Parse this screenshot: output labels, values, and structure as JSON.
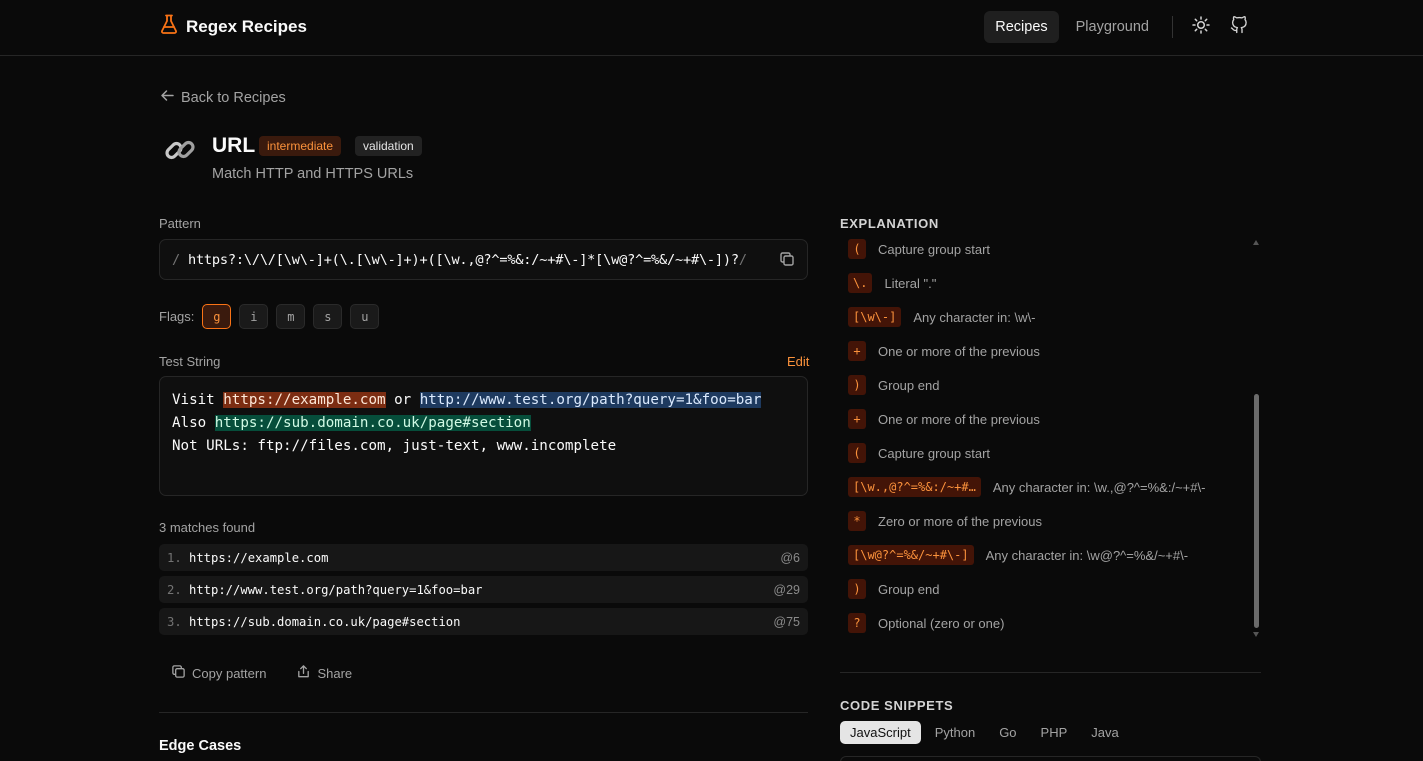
{
  "header": {
    "brand": "Regex Recipes",
    "nav": [
      {
        "label": "Recipes",
        "active": true
      },
      {
        "label": "Playground",
        "active": false
      }
    ],
    "icons": [
      "flask-icon",
      "sun-icon",
      "github-icon"
    ]
  },
  "back_link": "Back to Recipes",
  "recipe": {
    "icon": "link-icon",
    "title": "URL",
    "difficulty": "intermediate",
    "category": "validation",
    "description": "Match HTTP and HTTPS URLs"
  },
  "pattern": {
    "label": "Pattern",
    "open_delim": "/",
    "source": "https?:\\/\\/[\\w\\-]+(\\.[\\w\\-]+)+([\\w.,@?^=%&:/~+#\\-]*[\\w@?^=%&/~+#\\-])?",
    "close_delim": "/"
  },
  "flags": {
    "label": "Flags:",
    "items": [
      {
        "label": "g",
        "on": true
      },
      {
        "label": "i",
        "on": false
      },
      {
        "label": "m",
        "on": false
      },
      {
        "label": "s",
        "on": false
      },
      {
        "label": "u",
        "on": false
      }
    ]
  },
  "test_string": {
    "label": "Test String",
    "edit_label": "Edit",
    "line1_pre": "Visit ",
    "line1_m1": "https://example.com",
    "line1_mid": " or ",
    "line1_m2": "http://www.test.org/path?query=1&foo=bar",
    "line2_pre": "Also ",
    "line2_m3": "https://sub.domain.co.uk/page#section",
    "line3": "Not URLs: ftp://files.com, just-text, www.incomplete"
  },
  "matches": {
    "summary": "3 matches found",
    "items": [
      {
        "index": "1.",
        "value": "https://example.com",
        "pos": "@6"
      },
      {
        "index": "2.",
        "value": "http://www.test.org/path?query=1&foo=bar",
        "pos": "@29"
      },
      {
        "index": "3.",
        "value": "https://sub.domain.co.uk/page#section",
        "pos": "@75"
      }
    ]
  },
  "actions": {
    "copy": "Copy pattern",
    "share": "Share"
  },
  "edge_cases_title": "Edge Cases",
  "explanation": {
    "title": "EXPLANATION",
    "items": [
      {
        "token": "(",
        "desc": "Capture group start"
      },
      {
        "token": "\\.",
        "desc": "Literal \".\""
      },
      {
        "token": "[\\w\\-]",
        "desc": "Any character in: \\w\\-"
      },
      {
        "token": "+",
        "desc": "One or more of the previous"
      },
      {
        "token": ")",
        "desc": "Group end"
      },
      {
        "token": "+",
        "desc": "One or more of the previous"
      },
      {
        "token": "(",
        "desc": "Capture group start"
      },
      {
        "token": "[\\w.,@?^=%&:/~+#…",
        "desc": "Any character in: \\w.,@?^=%&:/~+#\\-"
      },
      {
        "token": "*",
        "desc": "Zero or more of the previous"
      },
      {
        "token": "[\\w@?^=%&/~+#\\-]",
        "desc": "Any character in: \\w@?^=%&/~+#\\-"
      },
      {
        "token": ")",
        "desc": "Group end"
      },
      {
        "token": "?",
        "desc": "Optional (zero or one)"
      }
    ]
  },
  "snippets": {
    "title": "CODE SNIPPETS",
    "tabs": [
      {
        "label": "JavaScript",
        "active": true
      },
      {
        "label": "Python",
        "active": false
      },
      {
        "label": "Go",
        "active": false
      },
      {
        "label": "PHP",
        "active": false
      },
      {
        "label": "Java",
        "active": false
      }
    ]
  },
  "colors": {
    "accent": "#f97316",
    "background": "#0a0a0a"
  }
}
